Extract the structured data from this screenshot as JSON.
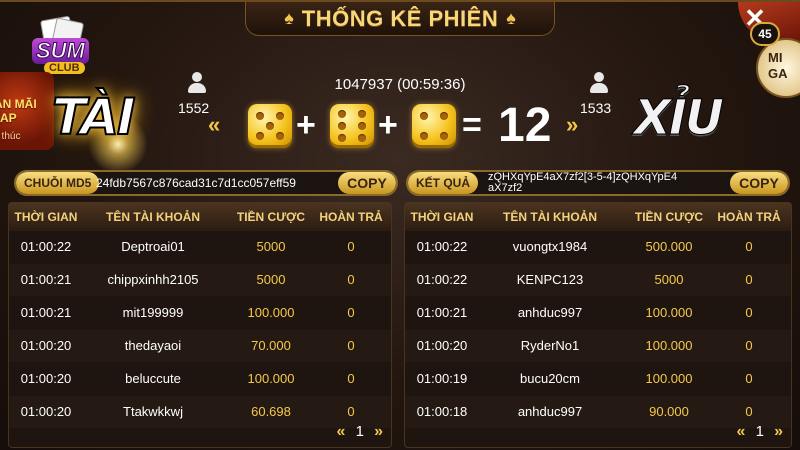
{
  "header": {
    "title": "THỐNG KÊ PHIÊN",
    "spade_left": "♠",
    "spade_right": "♠"
  },
  "logo": {
    "word1": "SUM",
    "word2": "CLUB"
  },
  "promo": {
    "line1": "ẦN MÃI",
    "line2": "AP",
    "line3": "t thúc"
  },
  "close_label": "✕",
  "timer_badge": "45",
  "side_button": {
    "line1": "MI",
    "line2": "GA"
  },
  "session": {
    "text": "1047937 (00:59:36)"
  },
  "tai": {
    "label": "TÀI",
    "count": "1552",
    "arrow": "«"
  },
  "xiu": {
    "label": "XỈU",
    "count": "1533",
    "arrow": "»"
  },
  "result": {
    "dice": [
      5,
      6,
      4
    ],
    "plus": "+",
    "equals": "=",
    "total": "12"
  },
  "md5": {
    "label": "CHUỖI MD5",
    "value": "24fdb7567c876cad31c7d1cc057eff59",
    "copy": "COPY"
  },
  "ket_qua": {
    "label": "KẾT QUẢ",
    "value_line1": "zQHXqYpE4aX7zf2[3-5-4]zQHXqYpE4",
    "value_line2": "aX7zf2",
    "copy": "COPY"
  },
  "columns": [
    "THỜI GIAN",
    "TÊN TÀI KHOẢN",
    "TIỀN CƯỢC",
    "HOÀN TRẢ"
  ],
  "tai_table": {
    "rows": [
      {
        "time": "01:00:22",
        "user": "Deptroai01",
        "bet": "5000",
        "refund": "0"
      },
      {
        "time": "01:00:21",
        "user": "chippxinhh2105",
        "bet": "5000",
        "refund": "0"
      },
      {
        "time": "01:00:21",
        "user": "mit199999",
        "bet": "100.000",
        "refund": "0"
      },
      {
        "time": "01:00:20",
        "user": "thedayaoi",
        "bet": "70.000",
        "refund": "0"
      },
      {
        "time": "01:00:20",
        "user": "beluccute",
        "bet": "100.000",
        "refund": "0"
      },
      {
        "time": "01:00:20",
        "user": "Ttakwkkwj",
        "bet": "60.698",
        "refund": "0"
      }
    ],
    "page": "1",
    "prev": "«",
    "next": "»"
  },
  "xiu_table": {
    "rows": [
      {
        "time": "01:00:22",
        "user": "vuongtx1984",
        "bet": "500.000",
        "refund": "0"
      },
      {
        "time": "01:00:22",
        "user": "KENPC123",
        "bet": "5000",
        "refund": "0"
      },
      {
        "time": "01:00:21",
        "user": "anhduc997",
        "bet": "100.000",
        "refund": "0"
      },
      {
        "time": "01:00:20",
        "user": "RyderNo1",
        "bet": "100.000",
        "refund": "0"
      },
      {
        "time": "01:00:19",
        "user": "bucu20cm",
        "bet": "100.000",
        "refund": "0"
      },
      {
        "time": "01:00:18",
        "user": "anhduc997",
        "bet": "90.000",
        "refund": "0"
      }
    ],
    "page": "1",
    "prev": "«",
    "next": "»"
  },
  "colors": {
    "gold": "#f5c84a",
    "dice": "#f5c21c",
    "background": "#23160f"
  }
}
